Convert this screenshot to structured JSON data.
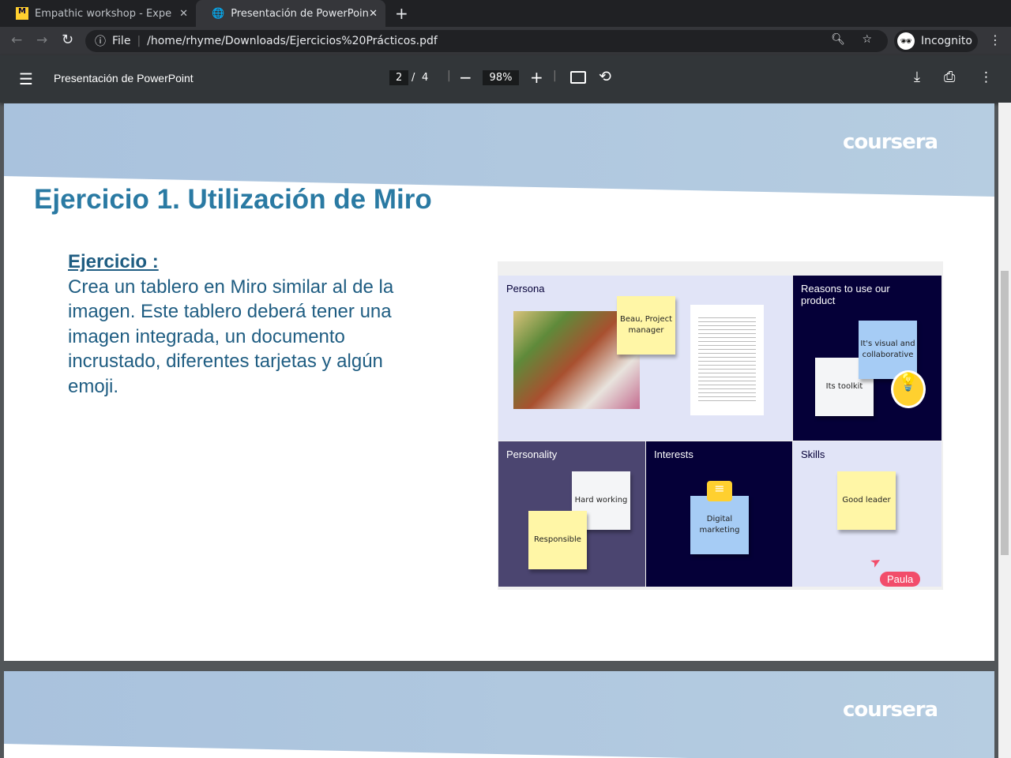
{
  "tabs": [
    {
      "title": "Empathic workshop - Expe",
      "icon": "miro-icon"
    },
    {
      "title": "Presentación de PowerPoin",
      "icon": "globe-icon"
    }
  ],
  "address": {
    "scheme": "File",
    "url": "/home/rhyme/Downloads/Ejercicios%20Prácticos.pdf",
    "profile": "Incognito"
  },
  "pdf": {
    "title": "Presentación de PowerPoint",
    "page": "2",
    "sep": "/",
    "total": "4",
    "zoom": "98%"
  },
  "slide": {
    "logo": "coursera",
    "title": "Ejercicio 1. Utilización de Miro",
    "heading": "Ejercicio :",
    "body": "Crea un tablero en Miro similar al de la imagen. Este tablero deberá tener una imagen integrada, un documento incrustado, diferentes tarjetas y algún emoji."
  },
  "board": {
    "persona": "Persona",
    "beau": "Beau, Project manager",
    "reasons": "Reasons to use our product",
    "visual": "It's visual and collaborative",
    "toolkit": "Its toolkit",
    "personality": "Personality",
    "hard": "Hard working",
    "responsible": "Responsible",
    "interests": "Interests",
    "digital": "Digital marketing",
    "skills": "Skills",
    "good": "Good leader",
    "cursor": "Paula"
  },
  "colors": {
    "title": "#2a7aa3",
    "body": "#1f5d82",
    "dark": "#050038"
  }
}
